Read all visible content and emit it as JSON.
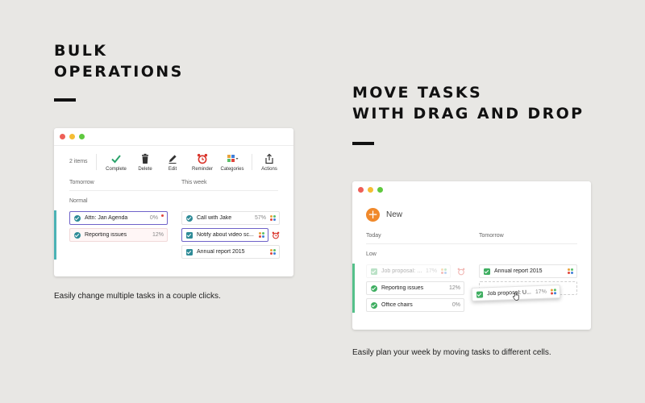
{
  "left": {
    "headline": [
      "BULK",
      "OPERATIONS"
    ],
    "caption": "Easily change multiple tasks in a couple clicks.",
    "toolbar": {
      "count": "2 items",
      "buttons": [
        {
          "label": "Complete",
          "icon": "checkmark-icon"
        },
        {
          "label": "Delete",
          "icon": "trash-icon"
        },
        {
          "label": "Edit",
          "icon": "pencil-icon"
        },
        {
          "label": "Reminder",
          "icon": "alarm-clock-icon"
        },
        {
          "label": "Categories",
          "icon": "categories-grid-icon"
        },
        {
          "label": "Actions",
          "icon": "share-icon"
        }
      ]
    },
    "columns": [
      "Tomorrow",
      "This week"
    ],
    "group": "Normal",
    "tasks": [
      {
        "name": "Attn: Jan Agenda",
        "pct": "0%"
      },
      {
        "name": "Reporting issues",
        "pct": "12%"
      },
      {
        "name": "Call with Jake",
        "pct": "57%"
      },
      {
        "name": "Notify about video sc...",
        "pct": ""
      },
      {
        "name": "Annual report 2015",
        "pct": ""
      }
    ]
  },
  "right": {
    "headline": [
      "MOVE TASKS",
      "WITH DRAG AND DROP"
    ],
    "caption": "Easily plan your week by moving tasks to different cells.",
    "new_label": "New",
    "columns": [
      "Today",
      "Tomorrow"
    ],
    "group": "Low",
    "tasks": [
      {
        "name": "Job proposal: U...",
        "pct": "17%"
      },
      {
        "name": "Reporting issues",
        "pct": "12%"
      },
      {
        "name": "Office chairs",
        "pct": "0%"
      },
      {
        "name": "Annual report 2015",
        "pct": ""
      },
      {
        "name": "Job proposal: U...",
        "pct": "17%"
      }
    ]
  },
  "colors": {
    "accent_purple": "#6f63c9",
    "teal": "#2e8b97",
    "green": "#3fae61",
    "orange": "#f0892b",
    "row_bar_left": "#4bb3b5",
    "row_bar_right": "#55c08a"
  }
}
